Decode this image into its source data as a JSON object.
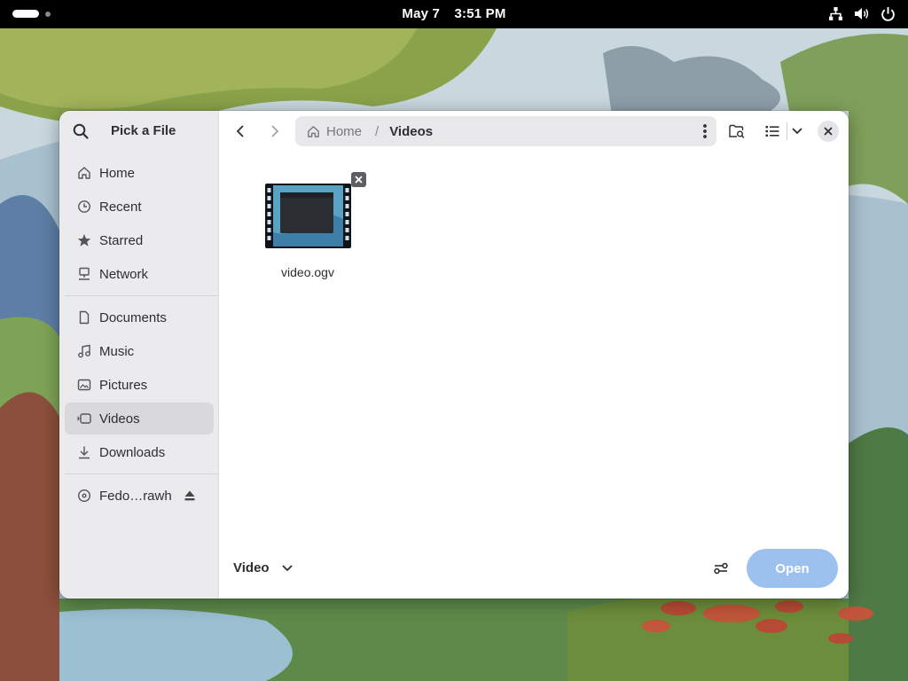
{
  "topbar": {
    "date": "May 7",
    "time": "3:51 PM",
    "icons": [
      "network-icon",
      "volume-icon",
      "power-icon"
    ]
  },
  "dialog": {
    "title": "Pick a File",
    "sidebar": {
      "places": [
        {
          "label": "Home",
          "icon": "home-icon"
        },
        {
          "label": "Recent",
          "icon": "clock-icon"
        },
        {
          "label": "Starred",
          "icon": "star-icon"
        },
        {
          "label": "Network",
          "icon": "network-icon"
        }
      ],
      "bookmarks": [
        {
          "label": "Documents",
          "icon": "document-icon"
        },
        {
          "label": "Music",
          "icon": "music-icon"
        },
        {
          "label": "Pictures",
          "icon": "image-icon"
        },
        {
          "label": "Videos",
          "icon": "video-icon",
          "selected": true
        },
        {
          "label": "Downloads",
          "icon": "download-icon"
        }
      ],
      "devices": [
        {
          "label": "Fedo…rawh",
          "icon": "disc-icon",
          "eject": true
        }
      ]
    },
    "pathbar": {
      "home": "Home",
      "separator": "/",
      "current": "Videos"
    },
    "files": [
      {
        "name": "video.ogv",
        "type": "video"
      }
    ],
    "footer": {
      "filter": "Video",
      "open_label": "Open"
    },
    "colors": {
      "accent_disabled": "#9dc1ef",
      "sidebar_bg": "#ebebed",
      "selected_bg": "#d9d9dc"
    }
  }
}
